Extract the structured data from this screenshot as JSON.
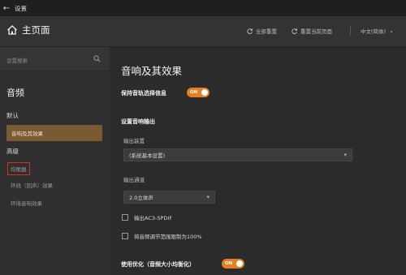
{
  "titlebar": {
    "back_icon": "arrow-left-icon",
    "title": "设置"
  },
  "header": {
    "home_icon": "home-icon",
    "home_label": "主页面",
    "reset_all": "全部重置",
    "reset_page": "重置当前页面",
    "language": "中文(简体)"
  },
  "sidebar": {
    "search_placeholder": "设置搜索",
    "section": "音频",
    "group_default": "默认",
    "item_sound": "音响及其效果",
    "group_advanced": "高级",
    "item_eq": "均衡器",
    "item_surround": "环绕（回声）效果",
    "item_env": "环境音响效果"
  },
  "main": {
    "title": "音响及其效果",
    "keep_track_label": "保持音轨选择信息",
    "keep_track_toggle": "ON",
    "output_section": "设置音响输出",
    "output_device_label": "输出装置",
    "output_device_value": "(系统基本设置)",
    "output_channel_label": "输出通道",
    "output_channel_value": "2.0立体声",
    "ac3_label": "输出AC3-SPDIF",
    "limit_label": "将音频调节范围限制为100%",
    "normalize_label": "使用优化（音频大小均衡化）",
    "normalize_toggle": "ON"
  },
  "colors": {
    "accent": "#e67e22",
    "active_item": "#7a5a33",
    "highlight_box": "#e02a2a"
  }
}
